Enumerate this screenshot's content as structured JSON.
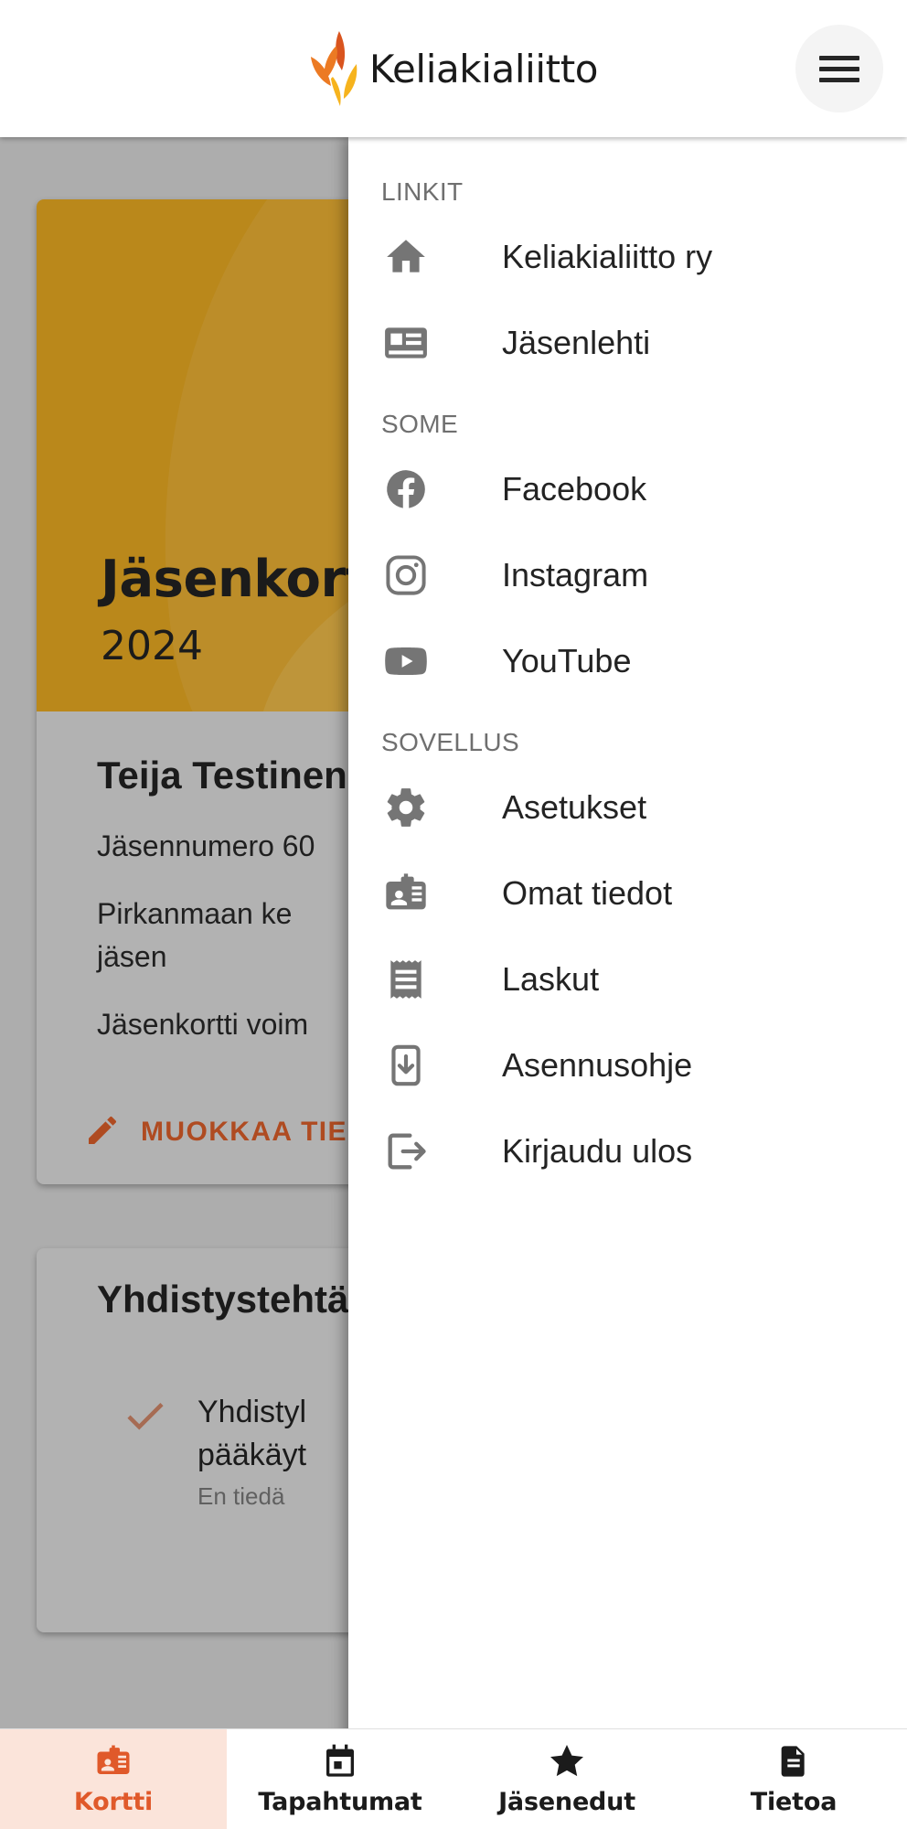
{
  "appbar": {
    "brand_name": "Keliakialiitto",
    "logo_icon": "wheat-logo-icon",
    "menu_icon": "hamburger-menu-icon",
    "logo_colors": {
      "dark_orange": "#d9541e",
      "mid_orange": "#ec7a23",
      "yellow": "#f6b31d"
    }
  },
  "drawer": {
    "sections": [
      {
        "label": "LINKIT",
        "items": [
          {
            "label": "Keliakialiitto ry",
            "icon": "home-icon"
          },
          {
            "label": "Jäsenlehti",
            "icon": "article-reader-icon"
          }
        ]
      },
      {
        "label": "SOME",
        "items": [
          {
            "label": "Facebook",
            "icon": "facebook-icon"
          },
          {
            "label": "Instagram",
            "icon": "instagram-icon"
          },
          {
            "label": "YouTube",
            "icon": "youtube-icon"
          }
        ]
      },
      {
        "label": "SOVELLUS",
        "items": [
          {
            "label": "Asetukset",
            "icon": "gear-icon"
          },
          {
            "label": "Omat tiedot",
            "icon": "id-badge-icon"
          },
          {
            "label": "Laskut",
            "icon": "receipt-icon"
          },
          {
            "label": "Asennusohje",
            "icon": "phone-download-icon"
          },
          {
            "label": "Kirjaudu ulos",
            "icon": "logout-icon"
          }
        ]
      }
    ]
  },
  "card": {
    "hero_title": "Jäsenkortti",
    "hero_year": "2024",
    "holder_name": "Teija Testinen",
    "member_number": "Jäsennumero 60",
    "association": "Pirkanmaan ke",
    "association_cont": "jäsen",
    "validity": "Jäsenkortti voim",
    "edit_label": "MUOKKAA TIE",
    "edit_icon": "pencil-icon",
    "accent_color": "#cb5422",
    "hero_color": "#d89c1b"
  },
  "tasks_card": {
    "title": "Yhdistystehtä",
    "rows": [
      {
        "icon": "check-icon",
        "line1": "Yhdistyl",
        "line2": "pääkäyt",
        "sub": "En tiedä"
      }
    ]
  },
  "bottom_nav": {
    "items": [
      {
        "label": "Kortti",
        "icon": "id-card-icon",
        "active": true
      },
      {
        "label": "Tapahtumat",
        "icon": "calendar-icon",
        "active": false
      },
      {
        "label": "Jäsenedut",
        "icon": "star-icon",
        "active": false
      },
      {
        "label": "Tietoa",
        "icon": "document-icon",
        "active": false
      }
    ],
    "active_color": "#e0592a",
    "active_bg": "#fbe4da"
  }
}
